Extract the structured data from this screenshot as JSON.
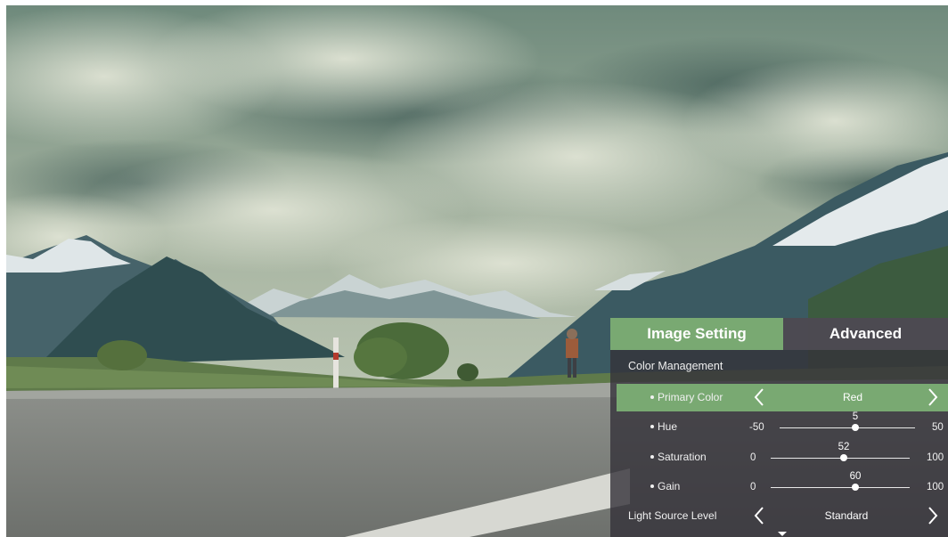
{
  "tabs": {
    "image_setting": "Image Setting",
    "advanced": "Advanced"
  },
  "section": {
    "title": "Color Management"
  },
  "primary_color": {
    "label": "Primary Color",
    "value": "Red"
  },
  "hue": {
    "label": "Hue",
    "min": "-50",
    "max": "50",
    "value": "5"
  },
  "saturation": {
    "label": "Saturation",
    "min": "0",
    "max": "100",
    "value": "52"
  },
  "gain": {
    "label": "Gain",
    "min": "0",
    "max": "100",
    "value": "60"
  },
  "light_source": {
    "label": "Light Source Level",
    "value": "Standard"
  },
  "colors": {
    "accent": "#79a972",
    "panel": "#34323a"
  }
}
